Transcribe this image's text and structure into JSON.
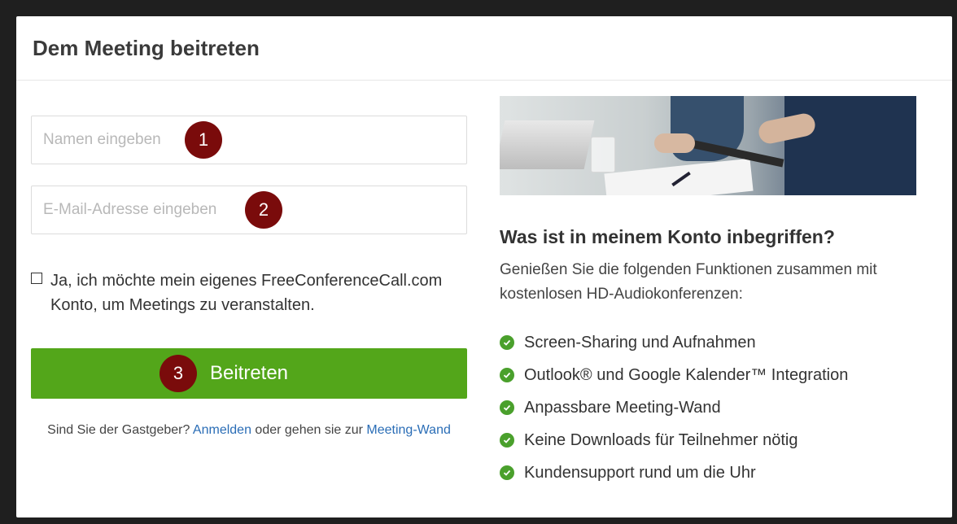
{
  "dialog": {
    "title": "Dem Meeting beitreten"
  },
  "form": {
    "name_placeholder": "Namen eingeben",
    "email_placeholder": "E-Mail-Adresse eingeben",
    "badges": [
      "1",
      "2",
      "3"
    ],
    "checkbox_label": "Ja, ich möchte mein eigenes FreeConferenceCall.com Konto, um Meetings zu veranstalten.",
    "checkbox_checked": false,
    "join_label": "Beitreten",
    "host_prefix": "Sind Sie der Gastgeber?",
    "login_link": "Anmelden",
    "host_middle": "oder gehen sie zur",
    "wall_link": "Meeting-Wand"
  },
  "info": {
    "title": "Was ist in meinem Konto inbegriffen?",
    "subtitle": "Genießen Sie die folgenden Funktionen zusammen mit kostenlosen HD-Audiokonferenzen:",
    "features": [
      "Screen-Sharing und Aufnahmen",
      "Outlook® und Google Kalender™ Integration",
      "Anpassbare Meeting-Wand",
      "Keine Downloads für Teilnehmer nötig",
      "Kundensupport rund um die Uhr"
    ]
  },
  "colors": {
    "accent_green": "#53a61a",
    "badge_red": "#7a0b0b",
    "link_blue": "#2a6db6",
    "check_green": "#4aa02c"
  },
  "icons": {
    "feature_bullet": "check-circle-icon"
  }
}
